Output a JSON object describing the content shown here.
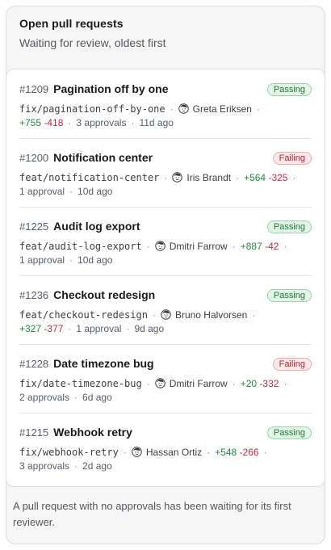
{
  "header": {
    "title": "Open pull requests",
    "subtitle": "Waiting for review, oldest first"
  },
  "pull_requests": [
    {
      "number": "#1209",
      "title": "Pagination off by one",
      "status": "Passing",
      "status_kind": "pass",
      "branch": "fix/pagination-off-by-one",
      "author": "Greta Eriksen",
      "additions": "+755",
      "deletions": "-418",
      "approvals": "3 approvals",
      "age": "11d ago"
    },
    {
      "number": "#1200",
      "title": "Notification center",
      "status": "Failing",
      "status_kind": "fail",
      "branch": "feat/notification-center",
      "author": "Iris Brandt",
      "additions": "+564",
      "deletions": "-325",
      "approvals": "1 approval",
      "age": "10d ago"
    },
    {
      "number": "#1225",
      "title": "Audit log export",
      "status": "Passing",
      "status_kind": "pass",
      "branch": "feat/audit-log-export",
      "author": "Dmitri Farrow",
      "additions": "+887",
      "deletions": "-42",
      "approvals": "1 approval",
      "age": "10d ago"
    },
    {
      "number": "#1236",
      "title": "Checkout redesign",
      "status": "Passing",
      "status_kind": "pass",
      "branch": "feat/checkout-redesign",
      "author": "Bruno Halvorsen",
      "additions": "+327",
      "deletions": "-377",
      "approvals": "1 approval",
      "age": "9d ago"
    },
    {
      "number": "#1228",
      "title": "Date timezone bug",
      "status": "Failing",
      "status_kind": "fail",
      "branch": "fix/date-timezone-bug",
      "author": "Dmitri Farrow",
      "additions": "+20",
      "deletions": "-332",
      "approvals": "2 approvals",
      "age": "6d ago"
    },
    {
      "number": "#1215",
      "title": "Webhook retry",
      "status": "Passing",
      "status_kind": "pass",
      "branch": "fix/webhook-retry",
      "author": "Hassan Ortiz",
      "additions": "+548",
      "deletions": "-266",
      "approvals": "3 approvals",
      "age": "2d ago"
    }
  ],
  "footer": {
    "note": "A pull request with no approvals has been waiting for its first reviewer."
  },
  "colors": {
    "passing": "#1f7a35",
    "failing": "#b42335",
    "additions": "#1f8a3b",
    "deletions": "#c02c46"
  },
  "icons": {
    "author_avatar": "avatar-icon"
  }
}
